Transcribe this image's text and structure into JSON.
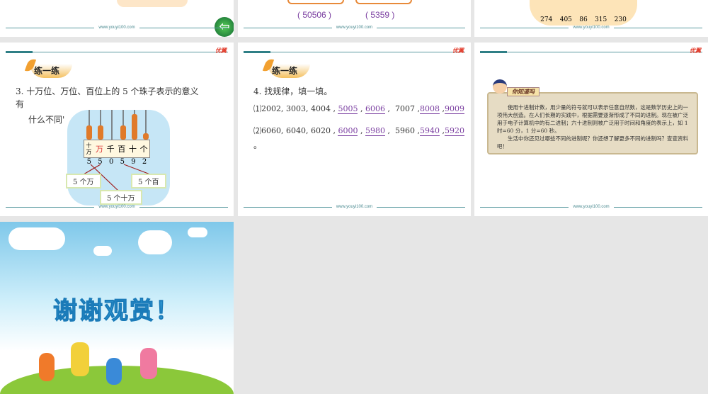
{
  "footer_url": "www.youyi100.com",
  "logo": "优翼",
  "row1": {
    "answers": [
      "50506",
      "5359"
    ],
    "abacus_numbers": [
      "274",
      "405",
      "86",
      "315",
      "230"
    ]
  },
  "slide_practice3": {
    "badge": "练一练",
    "question_line1": "3. 十万位、万位、百位上的 5 个珠子表示的意义",
    "question_line2": "有",
    "question_line3": "什么不同'",
    "places": [
      "十万",
      "万",
      "千",
      "百",
      "十",
      "个"
    ],
    "digits": [
      "5",
      "5",
      "0",
      "5",
      "9",
      "2"
    ],
    "labels": [
      "5 个万",
      "5 个百",
      "5 个十万"
    ]
  },
  "slide_practice4": {
    "badge": "练一练",
    "question": "4. 找规律，填一填。",
    "line1": {
      "prefix": "⑴2002, 3003, 4004 ,",
      "a1": "5005",
      "a2": "6006",
      "mid": "7007 ,",
      "a3": "8008",
      "a4": "9009"
    },
    "line2": {
      "prefix": "⑵6060, 6040, 6020 ,",
      "a1": "6000",
      "a2": "5980",
      "mid": "5960 ,",
      "a3": "5940",
      "a4": "5920"
    },
    "end": "。"
  },
  "slide_know": {
    "title": "你知道吗",
    "para1": "使用十进制计数，用少量的符号就可以表示任意自然数，这是数学历史上的一项伟大创造。在人们长期的实践中，根据需要逐渐形成了不同的进制。现在被广泛用于电子计算机中的有二进制；六十进制则被广泛用于时间和角度的表示上，如 1 时=60 分，1 分=60 秒。",
    "para2": "生活中你还见过哪些不同的进制呢？你还想了解更多不同的进制吗？查查资料吧！"
  },
  "slide_end": {
    "title": "谢谢观赏！"
  }
}
